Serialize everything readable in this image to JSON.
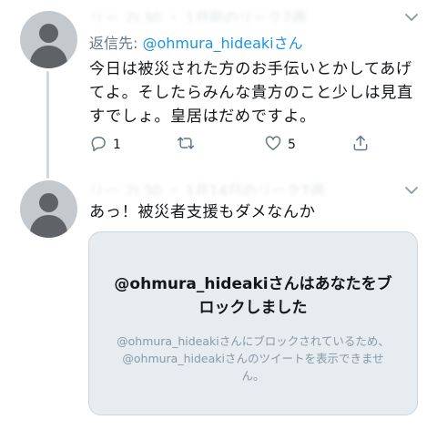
{
  "tweets": [
    {
      "header_blurred": "リー_2L30 ・ 1月前のリーク7週",
      "reply_prefix": "返信先: ",
      "reply_handle": "@ohmura_hideakiさん",
      "text": "今日は被災された方のお手伝いとかしてあげてよ。そしたらみんな貴方のこと少しは見直すでしょ。皇居はだめですよ。",
      "actions": {
        "reply_count": "1",
        "retweet_count": "",
        "like_count": "5"
      }
    },
    {
      "header_blurred": "リー_2L30 ・ 1月14日のリーク7週",
      "text": "あっ！被災者支援もダメなんか",
      "blocked": {
        "title": "@ohmura_hideakiさんはあなたをブロックしました",
        "description": "@ohmura_hideakiさんにブロックされているため、@ohmura_hideakiさんのツイートを表示できません。"
      }
    }
  ],
  "icons": {
    "caret": "chevron-down-icon",
    "reply": "reply-icon",
    "retweet": "retweet-icon",
    "like": "heart-icon",
    "share": "share-icon"
  },
  "colors": {
    "link": "#1b95e0",
    "secondary_text": "#657786",
    "card_bg": "#e6ecf0",
    "thread_line": "#cfd9de"
  }
}
